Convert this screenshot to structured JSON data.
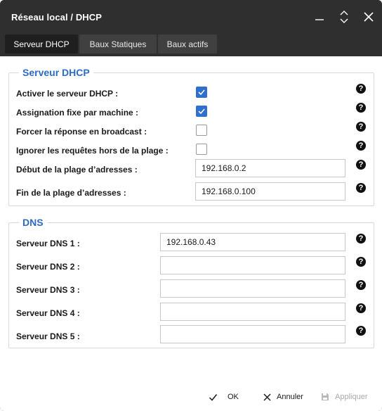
{
  "window": {
    "title": "Réseau local / DHCP"
  },
  "tabs": [
    {
      "label": "Serveur DHCP",
      "active": true
    },
    {
      "label": "Baux Statiques",
      "active": false
    },
    {
      "label": "Baux actifs",
      "active": false
    }
  ],
  "dhcp_group": {
    "title": "Serveur DHCP",
    "enable_label": "Activer le serveur DHCP :",
    "enable_checked": true,
    "fixed_label": "Assignation fixe par machine :",
    "fixed_checked": true,
    "broadcast_label": "Forcer la réponse en broadcast :",
    "broadcast_checked": false,
    "ignore_label": "Ignorer les requêtes hors de la plage :",
    "ignore_checked": false,
    "range_start_label": "Début de la plage d’adresses :",
    "range_start_value": "192.168.0.2",
    "range_end_label": "Fin de la plage d’adresses :",
    "range_end_value": "192.168.0.100"
  },
  "dns_group": {
    "title": "DNS",
    "dns1_label": "Serveur DNS 1 :",
    "dns1_value": "192.168.0.43",
    "dns2_label": "Serveur DNS 2 :",
    "dns2_value": "",
    "dns3_label": "Serveur DNS 3 :",
    "dns3_value": "",
    "dns4_label": "Serveur DNS 4 :",
    "dns4_value": "",
    "dns5_label": "Serveur DNS 5 :",
    "dns5_value": ""
  },
  "help_glyph": "?",
  "footer": {
    "ok_label": "OK",
    "cancel_label": "Annuler",
    "apply_label": "Appliquer",
    "apply_enabled": false
  },
  "colors": {
    "titlebar": "#2f2f2f",
    "active_tab": "#1f1f1f",
    "group_title": "#2d6bc4",
    "checkbox_checked": "#2f6fce"
  }
}
